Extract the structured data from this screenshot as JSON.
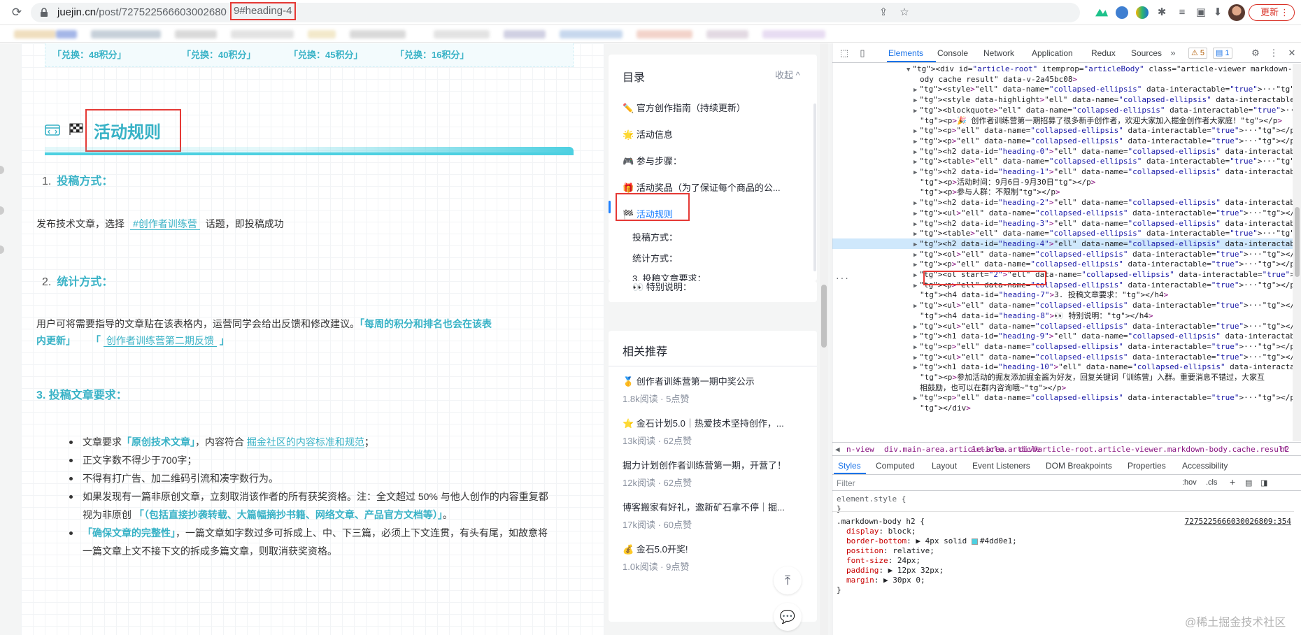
{
  "browser": {
    "url_host": "juejin.cn",
    "url_path": "/post/727522566603002680",
    "url_hash": "9#heading-4",
    "update_label": "更新",
    "accent": "#1a73e8"
  },
  "article": {
    "exchange_labels": [
      "「兑换：48积分」",
      "「兑换：40积分」",
      "「兑换：45积分」",
      "「兑换：16积分」"
    ],
    "heading_title": "活动规则",
    "h1_num": "1.",
    "h1_text": "投稿方式：",
    "p1_a": "发布技术文章，选择",
    "p1_tag": "#创作者训练营",
    "p1_b": "话题，即投稿成功",
    "h2_num": "2.",
    "h2_text": "统计方式：",
    "p2_a": "用户可将需要指导的文章贴在该表格内，运营同学会给出反馈和修改建议。",
    "p2_em1": "「每周的积分和排名也会在该表",
    "p2_em2": "内更新」",
    "p2_q1": "「",
    "p2_link": "创作者训练营第二期反馈",
    "p2_q2": "」",
    "h3_text": "3. 投稿文章要求：",
    "li1_a": "文章要求",
    "li1_em": "「原创技术文章」",
    "li1_b": "，内容符合",
    "li1_link": "掘金社区的内容标准和规范",
    "li1_c": "；",
    "li2": "正文字数不得少于700字；",
    "li3": "不得有打广告、加二维码引流和凑字数行为。",
    "li4_a": "如果发现有一篇非原创文章，立刻取消该作者的所有获奖资格。注：全文超过 50% 与他人创作的内容重复都",
    "li4_b": "视为非原创",
    "li4_em": "「（包括直接抄袭转载、大篇幅摘抄书籍、网络文章、产品官方文档等）」",
    "li4_c": "。",
    "li5_em": "「确保文章的完整性」",
    "li5_a": "，一篇文章如字数过多可拆成上、中、下三篇，必须上下文连贯，有头有尾，如故意将",
    "li6": "一篇文章上文不接下文的拆成多篇文章，则取消获奖资格。",
    "accent": "#38b2c6"
  },
  "toc": {
    "title": "目录",
    "collapse": "收起 ^",
    "items": [
      "官方创作指南（持续更新）",
      "活动信息",
      "参与步骤：",
      "活动奖品（为了保证每个商品的公...",
      "活动规则",
      "投稿方式：",
      "统计方式：",
      "3. 投稿文章要求：",
      "特别说明："
    ],
    "icons": [
      "✏️",
      "🌟",
      "🎮",
      "🎁",
      "🏁",
      "",
      "",
      "",
      "👀"
    ]
  },
  "related": {
    "title": "相关推荐",
    "items": [
      {
        "title": "🥇 创作者训练营第一期中奖公示",
        "meta": "1.8k阅读 · 5点赞"
      },
      {
        "title": "⭐ 金石计划5.0｜热爱技术坚持创作，...",
        "meta": "13k阅读 · 62点赞"
      },
      {
        "title": "掘力计划创作者训练营第一期，开营了！",
        "meta": "12k阅读 · 62点赞"
      },
      {
        "title": "博客搬家有好礼，邀新矿石拿不停｜掘...",
        "meta": "17k阅读 · 60点赞"
      },
      {
        "title": "💰 金石5.0开奖!",
        "meta": "1.0k阅读 · 9点赞"
      }
    ]
  },
  "devtools": {
    "tabs": [
      "Elements",
      "Console",
      "Network",
      "Application",
      "Redux",
      "Sources"
    ],
    "warn_count": "5",
    "msg_count": "1",
    "dom_lines": [
      {
        "ind": 0,
        "tri": "▼",
        "html": "<div id=\"article-root\" itemprop=\"articleBody\" class=\"article-viewer markdown-b"
      },
      {
        "ind": 1,
        "tri": "",
        "html": "ody cache result\" data-v-2a45bc08>"
      },
      {
        "ind": 1,
        "tri": "▶",
        "html": "<style>…</style>"
      },
      {
        "ind": 1,
        "tri": "▶",
        "html": "<style data-highlight>…</style>"
      },
      {
        "ind": 1,
        "tri": "▶",
        "html": "<blockquote>…</blockquote>"
      },
      {
        "ind": 1,
        "tri": "",
        "html": "<p>🎉 创作者训练营第一期招募了很多新手创作者，欢迎大家加入掘金创作者大家庭！</p>"
      },
      {
        "ind": 1,
        "tri": "▶",
        "html": "<p>…</p>"
      },
      {
        "ind": 1,
        "tri": "▶",
        "html": "<p>…</p>"
      },
      {
        "ind": 1,
        "tri": "▶",
        "html": "<h2 data-id=\"heading-0\">…</h2>"
      },
      {
        "ind": 1,
        "tri": "▶",
        "html": "<table>…</table>"
      },
      {
        "ind": 1,
        "tri": "▶",
        "html": "<h2 data-id=\"heading-1\">…</h2>"
      },
      {
        "ind": 1,
        "tri": "",
        "html": "<p>活动时间：9月6日-9月30日</p>"
      },
      {
        "ind": 1,
        "tri": "",
        "html": "<p>参与人群：不限制</p>"
      },
      {
        "ind": 1,
        "tri": "▶",
        "html": "<h2 data-id=\"heading-2\">…</h2>"
      },
      {
        "ind": 1,
        "tri": "▶",
        "html": "<ul>…</ul>"
      },
      {
        "ind": 1,
        "tri": "▶",
        "html": "<h2 data-id=\"heading-3\">…</h2>"
      },
      {
        "ind": 1,
        "tri": "▶",
        "html": "<table>…</table>"
      },
      {
        "ind": 1,
        "tri": "▶",
        "html": "<h2 data-id=\"heading-4\">…</h2> == $0",
        "sel": true
      },
      {
        "ind": 1,
        "tri": "▶",
        "html": "<ol>…</ol>"
      },
      {
        "ind": 1,
        "tri": "▶",
        "html": "<p>…</p>"
      },
      {
        "ind": 1,
        "tri": "▶",
        "html": "<ol start=\"2\">…</ol>"
      },
      {
        "ind": 1,
        "tri": "▶",
        "html": "<p>…</p>"
      },
      {
        "ind": 1,
        "tri": "",
        "html": "<h4 data-id=\"heading-7\">3. 投稿文章要求：</h4>"
      },
      {
        "ind": 1,
        "tri": "▶",
        "html": "<ul>…</ul>"
      },
      {
        "ind": 1,
        "tri": "",
        "html": "<h4 data-id=\"heading-8\">👀 特别说明：</h4>"
      },
      {
        "ind": 1,
        "tri": "▶",
        "html": "<ul>…</ul>"
      },
      {
        "ind": 1,
        "tri": "▶",
        "html": "<h1 data-id=\"heading-9\">…</h1>"
      },
      {
        "ind": 1,
        "tri": "▶",
        "html": "<p>…</p>"
      },
      {
        "ind": 1,
        "tri": "▶",
        "html": "<ul>…</ul>"
      },
      {
        "ind": 1,
        "tri": "▶",
        "html": "<h1 data-id=\"heading-10\">…</h1>"
      },
      {
        "ind": 1,
        "tri": "",
        "html": "<p>参加活动的掘友添加掘金酱为好友，回复关键词「训练营」入群。重要消息不错过，大家互"
      },
      {
        "ind": 1,
        "tri": "",
        "html": "相鼓励，也可以在群内咨询哦~</p>"
      },
      {
        "ind": 1,
        "tri": "▶",
        "html": "<p>…</p>"
      },
      {
        "ind": 1,
        "tri": "",
        "html": "</div>"
      }
    ],
    "crumbs": [
      "n-view",
      "div.main-area.article-area",
      "article.article",
      "div#article-root.article-viewer.markdown-body.cache.result",
      "h2"
    ],
    "sub_tabs": [
      "Styles",
      "Computed",
      "Layout",
      "Event Listeners",
      "DOM Breakpoints",
      "Properties",
      "Accessibility"
    ],
    "filter_placeholder": "Filter",
    "hov": ":hov",
    "cls": ".cls",
    "element_style": "element.style {",
    "close_brace": "}",
    "rule_selector": ".markdown-body h2 {",
    "rule_source": "7275225666030026809:354",
    "props": [
      {
        "name": "display",
        "value": "block;"
      },
      {
        "name": "border-bottom",
        "value": "▶ 4px solid  #4dd0e1;"
      },
      {
        "name": "position",
        "value": "relative;"
      },
      {
        "name": "font-size",
        "value": "24px;"
      },
      {
        "name": "padding",
        "value": "▶ 12px 32px;"
      },
      {
        "name": "margin",
        "value": "▶ 30px 0;"
      }
    ]
  },
  "watermark": "@稀土掘金技术社区"
}
